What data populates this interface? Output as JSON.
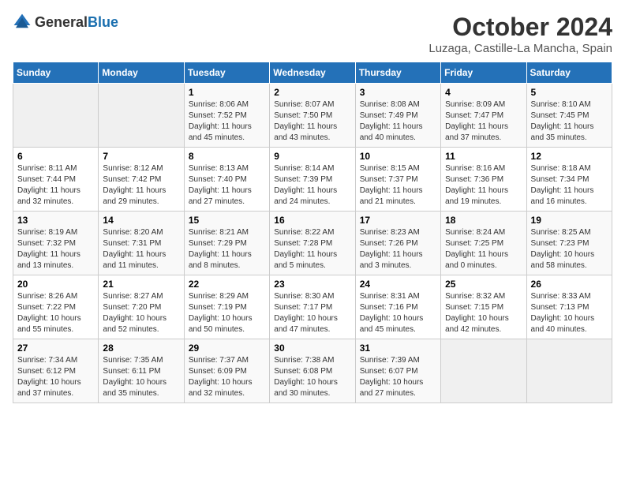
{
  "header": {
    "logo_general": "General",
    "logo_blue": "Blue",
    "month_year": "October 2024",
    "location": "Luzaga, Castille-La Mancha, Spain"
  },
  "days_of_week": [
    "Sunday",
    "Monday",
    "Tuesday",
    "Wednesday",
    "Thursday",
    "Friday",
    "Saturday"
  ],
  "weeks": [
    [
      {
        "day": "",
        "detail": ""
      },
      {
        "day": "",
        "detail": ""
      },
      {
        "day": "1",
        "detail": "Sunrise: 8:06 AM\nSunset: 7:52 PM\nDaylight: 11 hours and 45 minutes."
      },
      {
        "day": "2",
        "detail": "Sunrise: 8:07 AM\nSunset: 7:50 PM\nDaylight: 11 hours and 43 minutes."
      },
      {
        "day": "3",
        "detail": "Sunrise: 8:08 AM\nSunset: 7:49 PM\nDaylight: 11 hours and 40 minutes."
      },
      {
        "day": "4",
        "detail": "Sunrise: 8:09 AM\nSunset: 7:47 PM\nDaylight: 11 hours and 37 minutes."
      },
      {
        "day": "5",
        "detail": "Sunrise: 8:10 AM\nSunset: 7:45 PM\nDaylight: 11 hours and 35 minutes."
      }
    ],
    [
      {
        "day": "6",
        "detail": "Sunrise: 8:11 AM\nSunset: 7:44 PM\nDaylight: 11 hours and 32 minutes."
      },
      {
        "day": "7",
        "detail": "Sunrise: 8:12 AM\nSunset: 7:42 PM\nDaylight: 11 hours and 29 minutes."
      },
      {
        "day": "8",
        "detail": "Sunrise: 8:13 AM\nSunset: 7:40 PM\nDaylight: 11 hours and 27 minutes."
      },
      {
        "day": "9",
        "detail": "Sunrise: 8:14 AM\nSunset: 7:39 PM\nDaylight: 11 hours and 24 minutes."
      },
      {
        "day": "10",
        "detail": "Sunrise: 8:15 AM\nSunset: 7:37 PM\nDaylight: 11 hours and 21 minutes."
      },
      {
        "day": "11",
        "detail": "Sunrise: 8:16 AM\nSunset: 7:36 PM\nDaylight: 11 hours and 19 minutes."
      },
      {
        "day": "12",
        "detail": "Sunrise: 8:18 AM\nSunset: 7:34 PM\nDaylight: 11 hours and 16 minutes."
      }
    ],
    [
      {
        "day": "13",
        "detail": "Sunrise: 8:19 AM\nSunset: 7:32 PM\nDaylight: 11 hours and 13 minutes."
      },
      {
        "day": "14",
        "detail": "Sunrise: 8:20 AM\nSunset: 7:31 PM\nDaylight: 11 hours and 11 minutes."
      },
      {
        "day": "15",
        "detail": "Sunrise: 8:21 AM\nSunset: 7:29 PM\nDaylight: 11 hours and 8 minutes."
      },
      {
        "day": "16",
        "detail": "Sunrise: 8:22 AM\nSunset: 7:28 PM\nDaylight: 11 hours and 5 minutes."
      },
      {
        "day": "17",
        "detail": "Sunrise: 8:23 AM\nSunset: 7:26 PM\nDaylight: 11 hours and 3 minutes."
      },
      {
        "day": "18",
        "detail": "Sunrise: 8:24 AM\nSunset: 7:25 PM\nDaylight: 11 hours and 0 minutes."
      },
      {
        "day": "19",
        "detail": "Sunrise: 8:25 AM\nSunset: 7:23 PM\nDaylight: 10 hours and 58 minutes."
      }
    ],
    [
      {
        "day": "20",
        "detail": "Sunrise: 8:26 AM\nSunset: 7:22 PM\nDaylight: 10 hours and 55 minutes."
      },
      {
        "day": "21",
        "detail": "Sunrise: 8:27 AM\nSunset: 7:20 PM\nDaylight: 10 hours and 52 minutes."
      },
      {
        "day": "22",
        "detail": "Sunrise: 8:29 AM\nSunset: 7:19 PM\nDaylight: 10 hours and 50 minutes."
      },
      {
        "day": "23",
        "detail": "Sunrise: 8:30 AM\nSunset: 7:17 PM\nDaylight: 10 hours and 47 minutes."
      },
      {
        "day": "24",
        "detail": "Sunrise: 8:31 AM\nSunset: 7:16 PM\nDaylight: 10 hours and 45 minutes."
      },
      {
        "day": "25",
        "detail": "Sunrise: 8:32 AM\nSunset: 7:15 PM\nDaylight: 10 hours and 42 minutes."
      },
      {
        "day": "26",
        "detail": "Sunrise: 8:33 AM\nSunset: 7:13 PM\nDaylight: 10 hours and 40 minutes."
      }
    ],
    [
      {
        "day": "27",
        "detail": "Sunrise: 7:34 AM\nSunset: 6:12 PM\nDaylight: 10 hours and 37 minutes."
      },
      {
        "day": "28",
        "detail": "Sunrise: 7:35 AM\nSunset: 6:11 PM\nDaylight: 10 hours and 35 minutes."
      },
      {
        "day": "29",
        "detail": "Sunrise: 7:37 AM\nSunset: 6:09 PM\nDaylight: 10 hours and 32 minutes."
      },
      {
        "day": "30",
        "detail": "Sunrise: 7:38 AM\nSunset: 6:08 PM\nDaylight: 10 hours and 30 minutes."
      },
      {
        "day": "31",
        "detail": "Sunrise: 7:39 AM\nSunset: 6:07 PM\nDaylight: 10 hours and 27 minutes."
      },
      {
        "day": "",
        "detail": ""
      },
      {
        "day": "",
        "detail": ""
      }
    ]
  ]
}
